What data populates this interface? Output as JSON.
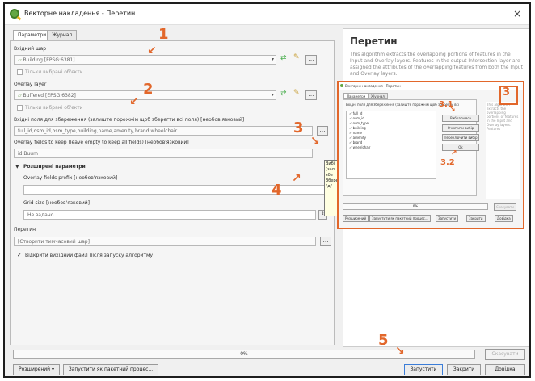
{
  "window": {
    "title": "Векторне накладення - Перетин",
    "close": "×"
  },
  "tabs": [
    {
      "label": "Параметри"
    },
    {
      "label": "Журнал"
    }
  ],
  "params": {
    "input_layer_label": "Вхідний шар",
    "input_layer_value": "Building [EPSG:6381]",
    "input_selected_only": "Тільки вибрані об'єкти",
    "overlay_layer_label": "Overlay layer",
    "overlay_layer_value": "Buffered [EPSG:6382]",
    "overlay_selected_only": "Тільки вибрані об'єкти",
    "input_fields_label": "Вхідні поля для збереження (залиште порожнім щоб зберегти всі поля) [необов'язковий]",
    "input_fields_value": "full_id,osm_id,osm_type,building,name,amenity,brand,wheelchair",
    "overlay_fields_label": "Overlay fields to keep (leave empty to keep all fields) [необов'язковий]",
    "overlay_fields_value": "id,Buum",
    "advanced_label": "Розширені параметри",
    "prefix_label": "Overlay fields prefix [необов'язковий]",
    "prefix_value": "",
    "grid_label": "Grid size [необов'язковий]",
    "grid_value": "Не задано",
    "output_label": "Перетин",
    "output_value": "[Створити тимчасовий шар]",
    "open_output": "Відкрити вихідний файл після запуску алгоритму"
  },
  "help": {
    "title": "Перетин",
    "text": "This algorithm extracts the overlapping portions of features in the Input and Overlay layers. Features in the output Intersection layer are assigned the attributes of the overlapping features from both the Input and Overlay layers."
  },
  "tooltip": {
    "text": "Вибі (зал збе Збере \"д\""
  },
  "progress": {
    "label": "0%",
    "value": 0
  },
  "buttons": {
    "advanced": "Розширений ▾",
    "batch": "Запустити як пакетний процес...",
    "run": "Запустити",
    "close": "Закрити",
    "help": "Довідка",
    "cancel": "Скасувати"
  },
  "annotations": {
    "n1": "1",
    "n2": "2",
    "n3": "3",
    "n4": "4",
    "n5": "5",
    "n31": "3.1",
    "n32": "3.2",
    "n3b": "3"
  },
  "inset": {
    "title": "Векторне накладення - Перетин",
    "tabs": [
      "Параметри",
      "Журнал"
    ],
    "header": "Вхідні поля для збереження (залиште порожнім щоб зберегти всі",
    "fields": [
      "full_id",
      "osm_id",
      "osm_type",
      "building",
      "name",
      "amenity",
      "brand",
      "wheelchair"
    ],
    "btn_select_all": "Вибрати все",
    "btn_clear": "Очистити вибір",
    "btn_toggle": "Переключити вибір",
    "btn_ok": "Ok",
    "help_text": "This algorithm extracts the overlapping portions of features in the Input and Overlay layers. Features",
    "progress": "0%",
    "bottom_buttons": [
      "Розширений",
      "Запустити як пакетний процес...",
      "Запустити",
      "Закрити",
      "Довідка"
    ],
    "cancel": "Скасувати"
  },
  "colors": {
    "annotation": "#e2672b",
    "qgis_green": "#64a743"
  }
}
